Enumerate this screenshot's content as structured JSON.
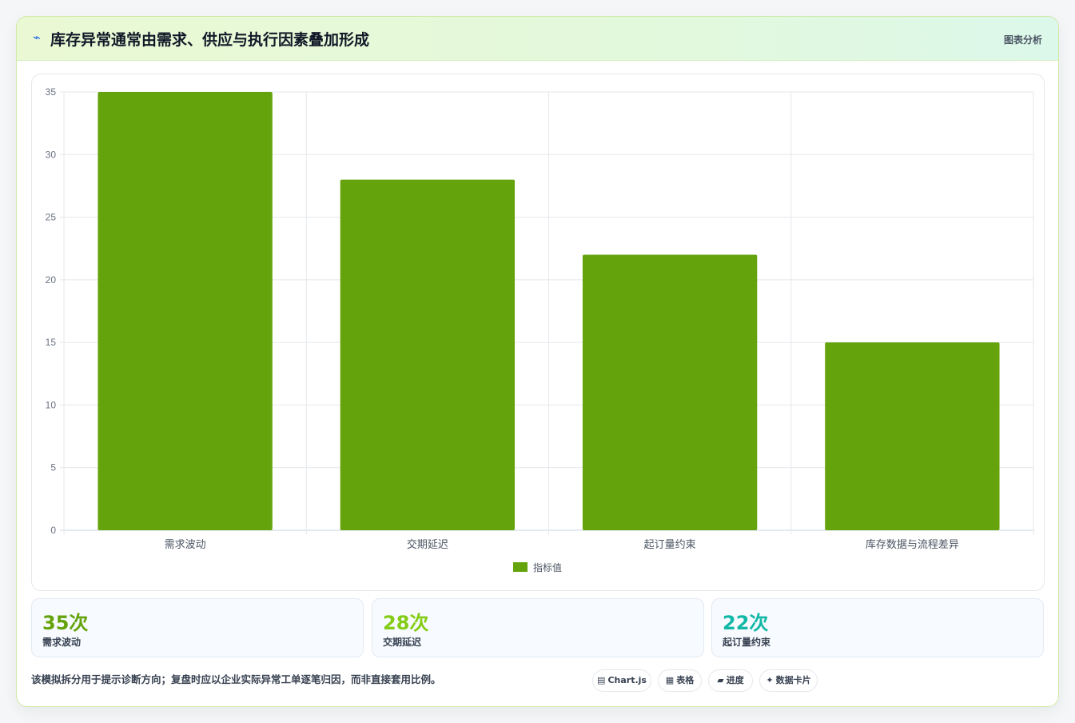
{
  "header": {
    "title": "库存异常通常由需求、供应与执行因素叠加形成",
    "tag": "图表分析"
  },
  "chart_data": {
    "type": "bar",
    "categories": [
      "需求波动",
      "交期延迟",
      "起订量约束",
      "库存数据与流程差异"
    ],
    "series": [
      {
        "name": "指标值",
        "values": [
          35,
          28,
          22,
          15
        ],
        "color": "#65a30d"
      }
    ],
    "ylim": [
      0,
      35
    ],
    "yticks": [
      0,
      5,
      10,
      15,
      20,
      25,
      30,
      35
    ],
    "legend": "bottom",
    "grid": true
  },
  "stats": [
    {
      "value": "35次",
      "label": "需求波动",
      "color": "#65a30d"
    },
    {
      "value": "28次",
      "label": "交期延迟",
      "color": "#84cc16"
    },
    {
      "value": "22次",
      "label": "起订量约束",
      "color": "#14b8a6"
    }
  ],
  "footnote": "该模拟拆分用于提示诊断方向；复盘时应以企业实际异常工单逐笔归因，而非直接套用比例。",
  "pills": [
    {
      "icon": "▤",
      "label": "Chart.js"
    },
    {
      "icon": "▦",
      "label": "表格"
    },
    {
      "icon": "▰",
      "label": "进度"
    },
    {
      "icon": "✦",
      "label": "数据卡片"
    }
  ]
}
